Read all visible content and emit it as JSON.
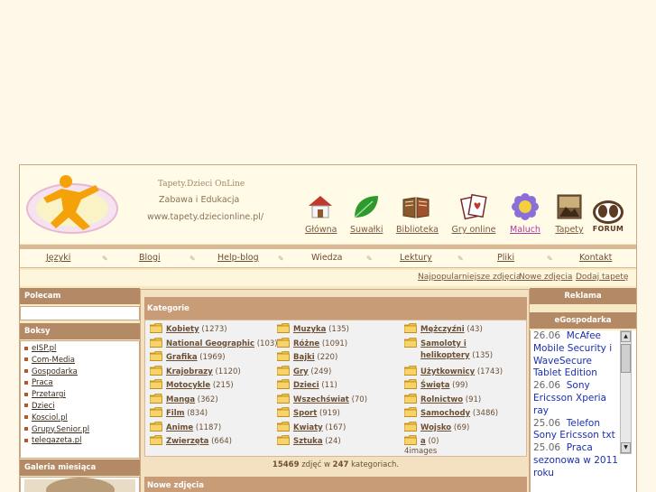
{
  "site": {
    "title": "Tapety.Dzieci OnLine",
    "subtitle": "Zabawa i Edukacja",
    "url": "www.tapety.dziecionline.pl/"
  },
  "nav_icons": [
    {
      "label": "Główna",
      "icon": "house-icon"
    },
    {
      "label": "Suwałki",
      "icon": "leaf-icon"
    },
    {
      "label": "Biblioteka",
      "icon": "book-icon"
    },
    {
      "label": "Gry online",
      "icon": "cards-icon"
    },
    {
      "label": "Maluch",
      "icon": "flower-icon"
    },
    {
      "label": "Tapety",
      "icon": "photo-icon"
    }
  ],
  "forum": {
    "label": "FORUM"
  },
  "menu": [
    "Języki",
    "Blogi",
    "Help-blog",
    "Wiedza",
    "Lektury",
    "Pliki",
    "Kontakt"
  ],
  "menu_separator": "✎",
  "sublinks": [
    "Najpopularniejsze zdjęcia",
    "Nowe zdjęcia",
    "Dodaj tapetę"
  ],
  "left": {
    "polecam_title": "Polecam",
    "boksy_title": "Boksy",
    "boksy_links": [
      "eISP.pl",
      "Com-Media",
      "Gospodarka",
      "Praca",
      "Przetargi",
      "Dzieci",
      "Kosciol.pl",
      "Grupy.Senior.pl",
      "telegazeta.pl"
    ],
    "galeria_title": "Galeria miesiąca"
  },
  "categories": {
    "title": "Kategorie",
    "col1": [
      {
        "name": "Kobiety",
        "count": "(1273)"
      },
      {
        "name": "National Geographic",
        "count": "(103)"
      },
      {
        "name": "Grafika",
        "count": "(1969)"
      },
      {
        "name": "Krajobrazy",
        "count": "(1120)"
      },
      {
        "name": "Motocykle",
        "count": "(215)"
      },
      {
        "name": "Manga",
        "count": "(362)"
      },
      {
        "name": "Film",
        "count": "(834)"
      },
      {
        "name": "Anime",
        "count": "(1187)"
      },
      {
        "name": "Zwierzęta",
        "count": "(664)"
      }
    ],
    "col2": [
      {
        "name": "Muzyka",
        "count": "(135)"
      },
      {
        "name": "Różne",
        "count": "(1091)"
      },
      {
        "name": "Bajki",
        "count": "(220)"
      },
      {
        "name": "Gry",
        "count": "(249)"
      },
      {
        "name": "Dzieci",
        "count": "(11)"
      },
      {
        "name": "Wszechświat",
        "count": "(70)"
      },
      {
        "name": "Sport",
        "count": "(919)"
      },
      {
        "name": "Kwiaty",
        "count": "(167)"
      },
      {
        "name": "Sztuka",
        "count": "(24)"
      }
    ],
    "col3": [
      {
        "name": "Mężczyźni",
        "count": "(43)"
      },
      {
        "name": "Samoloty i",
        "count": ""
      },
      {
        "name": "helikoptery",
        "count": "(135)"
      },
      {
        "name": "Użytkownicy",
        "count": "(1743)"
      },
      {
        "name": "Święta",
        "count": "(99)"
      },
      {
        "name": "Rolnictwo",
        "count": "(91)"
      },
      {
        "name": "Samochody",
        "count": "(3486)"
      },
      {
        "name": "Wojsko",
        "count": "(69)"
      },
      {
        "name": "a",
        "count": "(0)"
      }
    ],
    "extra_link": "4images",
    "footer": {
      "photos": "15469",
      "text1": "zdjęć w",
      "cats": "247",
      "text2": "kategoriach."
    },
    "new_title": "Nowe zdjęcia"
  },
  "right": {
    "reklama_title": "Reklama",
    "egospodarka_title": "eGospodarka",
    "news": [
      {
        "date": "26.06",
        "title": "McAfee Mobile Security i WaveSecure Tablet Edition"
      },
      {
        "date": "26.06",
        "title": "Sony Ericsson Xperia ray"
      },
      {
        "date": "25.06",
        "title": "Telefon Sony Ericsson txt"
      },
      {
        "date": "25.06",
        "title": "Praca sezonowa w 2011 roku"
      }
    ]
  }
}
